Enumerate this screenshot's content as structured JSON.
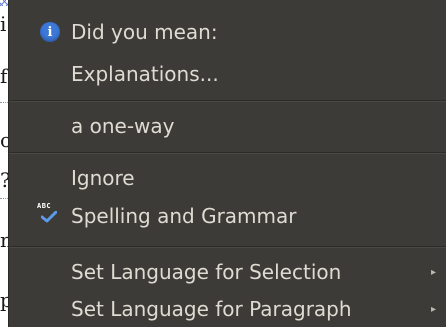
{
  "document": {
    "fragments": [
      "i",
      "f",
      "o",
      "?",
      "n",
      "p"
    ]
  },
  "menu": {
    "suggestion_header": {
      "label": "Did you mean:",
      "icon": "info-icon"
    },
    "explanations": {
      "label": "Explanations..."
    },
    "suggestions": [
      {
        "label": "a one-way"
      }
    ],
    "ignore": {
      "label": "Ignore"
    },
    "spelling_grammar": {
      "label": "Spelling and Grammar",
      "icon": "spellcheck-icon"
    },
    "language_items": [
      {
        "label": "Set Language for Selection",
        "has_submenu": true
      },
      {
        "label": "Set Language for Paragraph",
        "has_submenu": true
      }
    ]
  },
  "colors": {
    "menu_bg": "#3c3b37",
    "menu_text": "#dfdbd2",
    "info_blue": "#3b78d8",
    "check_blue": "#5b9be8"
  }
}
